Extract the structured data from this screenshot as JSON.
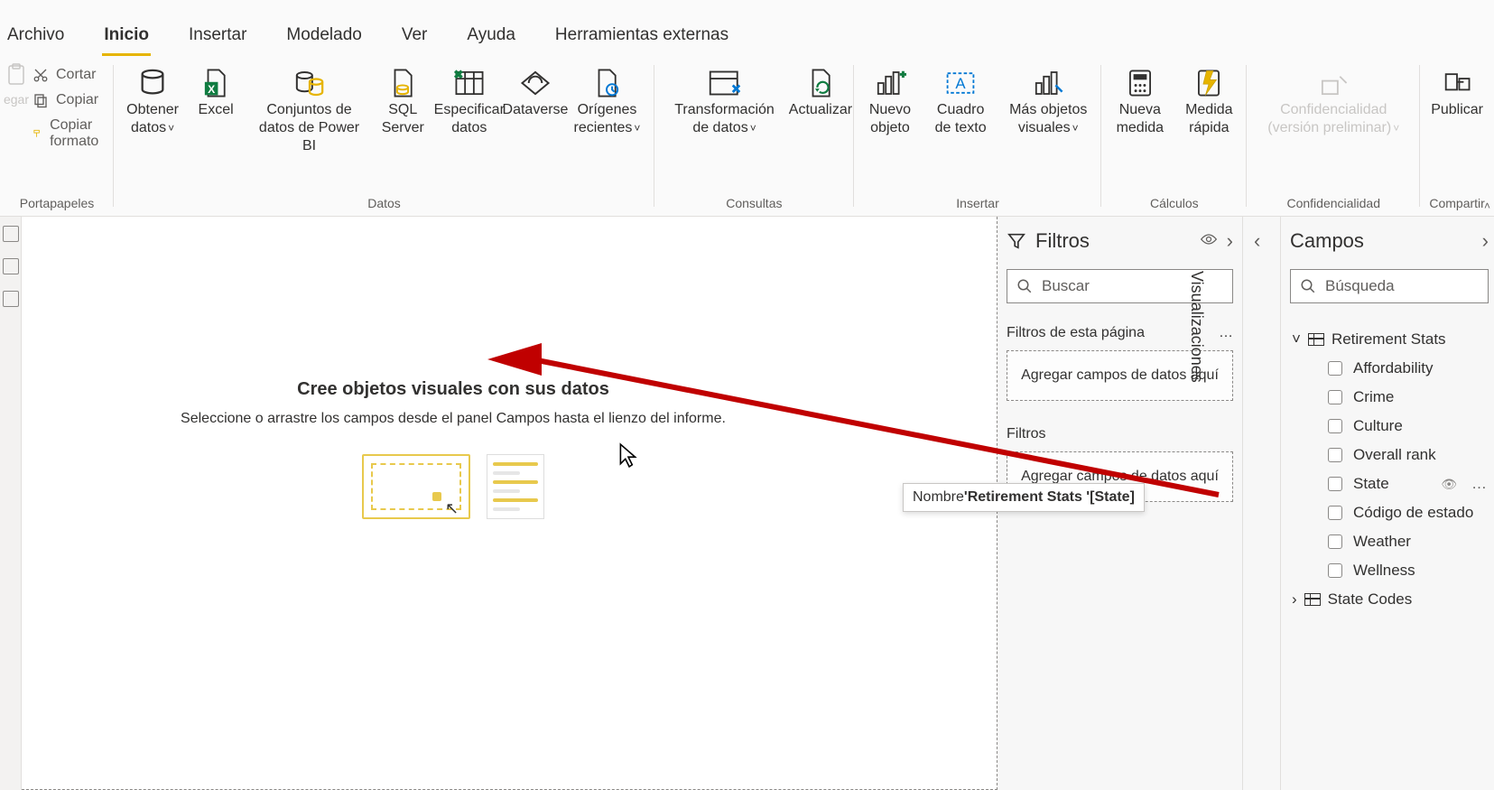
{
  "tabs": {
    "archivo": "Archivo",
    "inicio": "Inicio",
    "insertar": "Insertar",
    "modelado": "Modelado",
    "ver": "Ver",
    "ayuda": "Ayuda",
    "herramientas": "Herramientas externas"
  },
  "clipboard": {
    "paste": "egar",
    "cut": "Cortar",
    "copy": "Copiar",
    "format": "Copiar formato",
    "group": "Portapapeles"
  },
  "data_group": {
    "group": "Datos",
    "get_data": "Obtener datos",
    "excel": "Excel",
    "pbi_datasets": "Conjuntos de datos de Power BI",
    "sql": "SQL Server",
    "enter": "Especificar datos",
    "dataverse": "Dataverse",
    "recent": "Orígenes recientes"
  },
  "queries_group": {
    "group": "Consultas",
    "transform": "Transformación de datos",
    "refresh": "Actualizar"
  },
  "insert_group": {
    "group": "Insertar",
    "new_visual": "Nuevo objeto",
    "textbox": "Cuadro de texto",
    "more_visuals": "Más objetos visuales"
  },
  "calc_group": {
    "group": "Cálculos",
    "new_measure": "Nueva medida",
    "quick_measure": "Medida rápida"
  },
  "sensitivity_group": {
    "group": "Confidencialidad",
    "label": "Confidencialidad (versión preliminar)"
  },
  "share_group": {
    "group": "Compartir",
    "publish": "Publicar"
  },
  "canvas": {
    "title": "Cree objetos visuales con sus datos",
    "subtitle": "Seleccione o arrastre los campos desde el panel Campos hasta el lienzo del informe."
  },
  "filters": {
    "title": "Filtros",
    "search_placeholder": "Buscar",
    "page_header": "Filtros de esta página",
    "dropzone": "Agregar campos de datos aquí",
    "all_header": "Filtros"
  },
  "viz": {
    "label": "Visualizaciones"
  },
  "fields": {
    "title": "Campos",
    "search_placeholder": "Búsqueda",
    "tables": [
      {
        "name": "Retirement Stats",
        "expanded": true,
        "columns": [
          "Affordability",
          "Crime",
          "Culture",
          "Overall rank",
          "State",
          "Código de estado",
          "Weather",
          "Wellness"
        ]
      },
      {
        "name": "State Codes",
        "expanded": false,
        "columns": []
      }
    ]
  },
  "tooltip": {
    "label": "Nombre",
    "value": "'Retirement Stats '[State]"
  }
}
